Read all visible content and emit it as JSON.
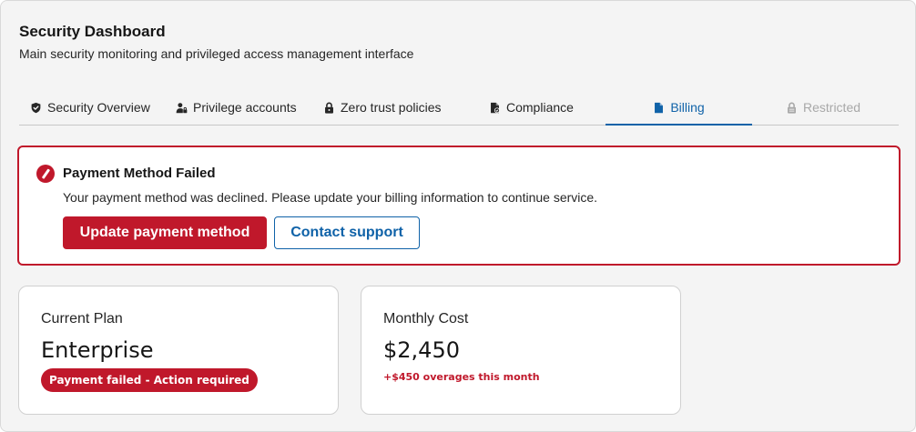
{
  "header": {
    "title": "Security Dashboard",
    "subtitle": "Main security monitoring and privileged access management interface"
  },
  "tabs": [
    {
      "label": "Security Overview",
      "icon": "shield-icon",
      "state": "default"
    },
    {
      "label": "Privilege accounts",
      "icon": "user-lock-icon",
      "state": "default"
    },
    {
      "label": "Zero trust policies",
      "icon": "lock-icon",
      "state": "default"
    },
    {
      "label": "Compliance",
      "icon": "document-check-icon",
      "state": "default"
    },
    {
      "label": "Billing",
      "icon": "document-icon",
      "state": "active"
    },
    {
      "label": "Restricted",
      "icon": "lock-icon",
      "state": "disabled"
    }
  ],
  "alert": {
    "icon": "error-circle-icon",
    "title": "Payment Method Failed",
    "message": "Your payment method was declined. Please update your billing information to continue service.",
    "primary_button": "Update payment method",
    "secondary_button": "Contact support"
  },
  "cards": {
    "plan": {
      "label": "Current Plan",
      "value": "Enterprise",
      "badge": "Payment failed - Action required"
    },
    "cost": {
      "label": "Monthly Cost",
      "value": "$2,450",
      "note": "+$450 overages this month"
    }
  },
  "colors": {
    "accent": "#0f62a8",
    "danger": "#c0182b",
    "border": "#d0d0d0"
  }
}
